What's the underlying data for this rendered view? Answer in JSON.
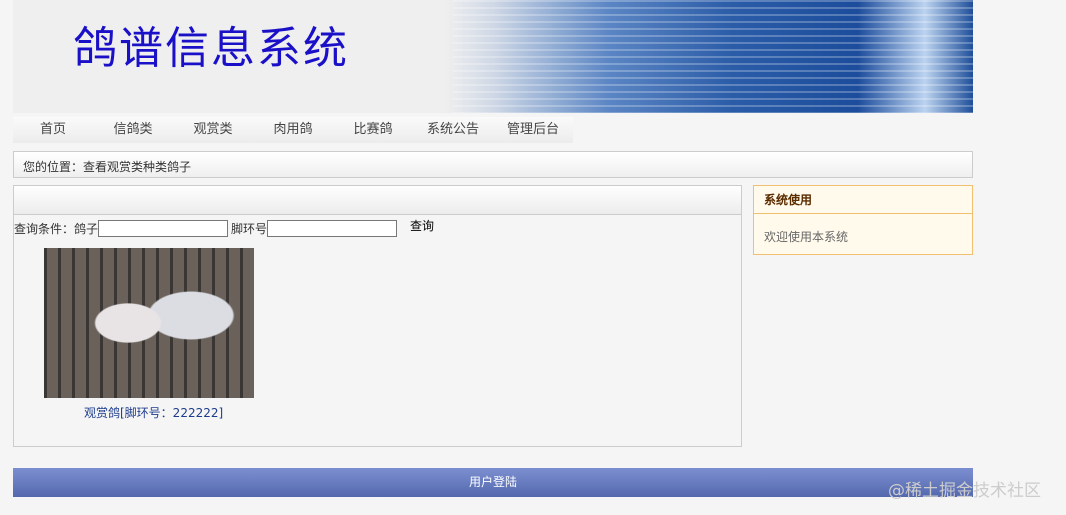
{
  "header": {
    "title": "鸽谱信息系统"
  },
  "nav": [
    "首页",
    "信鸽类",
    "观赏类",
    "肉用鸽",
    "比赛鸽",
    "系统公告",
    "管理后台"
  ],
  "breadcrumb": "您的位置：查看观赏类种类鸽子",
  "query": {
    "label1": "查询条件：鸽子",
    "value1": "",
    "label2": "脚环号",
    "value2": "",
    "button": "查询"
  },
  "items": [
    {
      "caption": "观赏鸽[脚环号：222222]"
    }
  ],
  "sidebar": {
    "title": "系统使用",
    "text": "欢迎使用本系统"
  },
  "footer": {
    "login": "用户登陆"
  },
  "watermark": "@稀土掘金技术社区"
}
